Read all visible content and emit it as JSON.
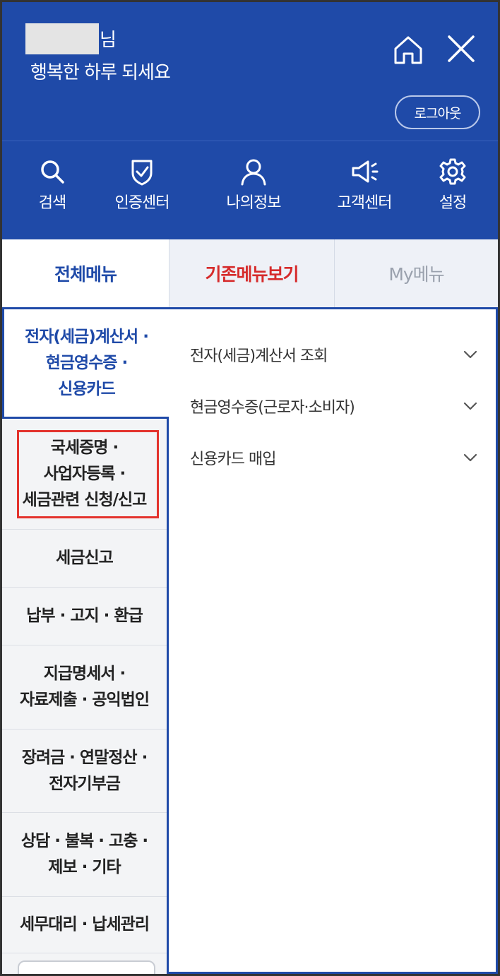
{
  "header": {
    "greeting_suffix": "님",
    "greeting_message": "행복한 하루 되세요",
    "logout_label": "로그아웃",
    "background_color": "#1f4aa8"
  },
  "quick_menu": [
    {
      "label": "검색",
      "icon": "search-icon"
    },
    {
      "label": "인증센터",
      "icon": "shield-check-icon"
    },
    {
      "label": "나의정보",
      "icon": "user-icon"
    },
    {
      "label": "고객센터",
      "icon": "megaphone-icon"
    },
    {
      "label": "설정",
      "icon": "gear-icon"
    }
  ],
  "tabs": [
    {
      "label": "전체메뉴",
      "active": true
    },
    {
      "label": "기존메뉴보기",
      "color": "#d62b2b"
    },
    {
      "label": "My메뉴"
    }
  ],
  "categories": [
    {
      "label_lines": [
        "전자(세금)계산서 ·",
        "현금영수증 ·",
        "신용카드"
      ],
      "active": true
    },
    {
      "label_lines": [
        "국세증명 ·",
        "사업자등록 ·",
        "세금관련 신청/신고"
      ],
      "highlighted": true
    },
    {
      "label_lines": [
        "세금신고"
      ]
    },
    {
      "label_lines": [
        "납부 · 고지 · 환급"
      ]
    },
    {
      "label_lines": [
        "지급명세서 ·",
        "자료제출 · 공익법인"
      ]
    },
    {
      "label_lines": [
        "장려금 · 연말정산 ·",
        "전자기부금"
      ]
    },
    {
      "label_lines": [
        "상담 · 불복 · 고충 ·",
        "제보 · 기타"
      ]
    },
    {
      "label_lines": [
        "세무대리 · 납세관리"
      ]
    }
  ],
  "submenu": [
    {
      "label": "전자(세금)계산서 조회",
      "icon": "chevron-down-icon"
    },
    {
      "label": "현금영수증(근로자·소비자)",
      "icon": "chevron-down-icon"
    },
    {
      "label": "신용카드 매입",
      "icon": "chevron-down-icon"
    }
  ]
}
